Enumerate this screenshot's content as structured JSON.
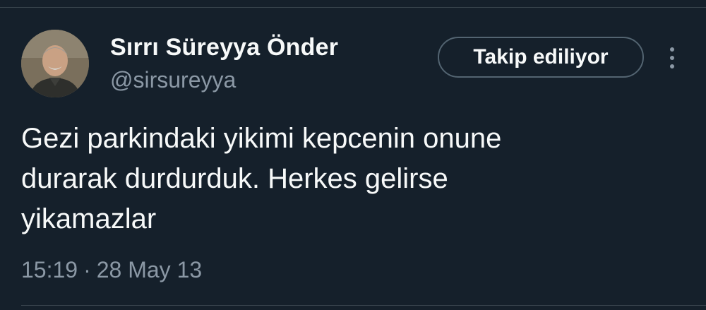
{
  "tweet": {
    "author": {
      "display_name": "Sırrı Süreyya Önder",
      "handle": "@sirsureyya",
      "avatar_icon": "profile-photo"
    },
    "follow_button_label": "Takip ediliyor",
    "more_icon": "more-vertical-icon",
    "text_lines": [
      "Gezi parkindaki yikimi kepcenin onune",
      "durarak durdurduk. Herkes gelirse",
      "yikamazlar"
    ],
    "time": "15:19",
    "separator": "·",
    "date": "28 May 13"
  },
  "colors": {
    "background": "#15202b",
    "primary_text": "#f7f9f9",
    "secondary_text": "#8b98a5",
    "border": "#536471"
  }
}
